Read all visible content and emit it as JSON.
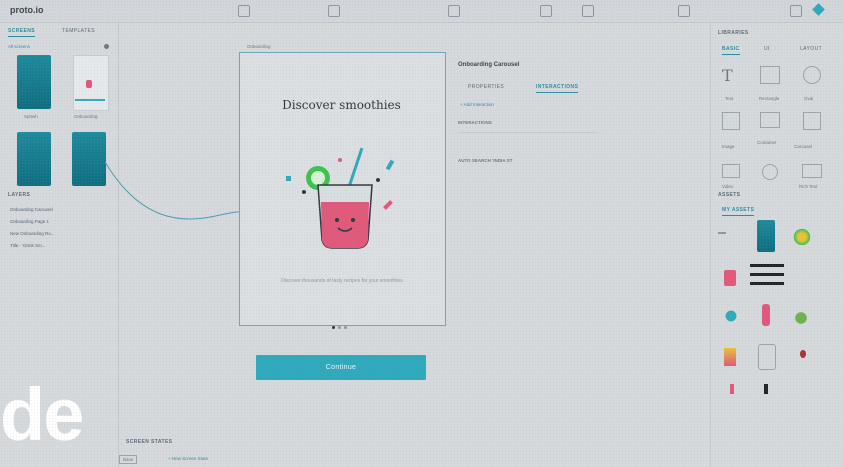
{
  "app": {
    "logo": "proto.io"
  },
  "left_panel": {
    "tabs": [
      "SCREENS",
      "TEMPLATES"
    ],
    "filter_label": "All screens",
    "screens": [
      {
        "label": "Splash"
      },
      {
        "label": "Onboarding"
      },
      {
        "label": ""
      },
      {
        "label": ""
      }
    ],
    "layers_title": "LAYERS",
    "layers": [
      "Onboarding Carousel",
      "Onboarding Page 1",
      "New Onboarding Ro...",
      "Title - 'Drink Sm..."
    ]
  },
  "canvas": {
    "artboard_title": "Discover smoothies",
    "artboard_caption": "Discover thousands of tasty recipes for your smoothies",
    "continue_label": "Continue"
  },
  "props_panel": {
    "title": "Onboarding Carousel",
    "tabs": [
      "PROPERTIES",
      "INTERACTIONS"
    ],
    "add_interaction": "+ Add Interaction",
    "interaction_label": "INTERACTIONS",
    "auto_label": "AUTO SEARCH 'INDIA ST"
  },
  "right_panel": {
    "library_title": "LIBRARIES",
    "library_tabs": [
      "BASIC",
      "UI",
      "LAYOUT"
    ],
    "items": [
      "Text",
      "Rectangle",
      "Oval",
      "Image",
      "Container",
      "Carousel",
      "Video",
      "",
      "Rich Text"
    ],
    "assets_title": "ASSETS",
    "assets_tab": "MY ASSETS"
  },
  "bottom_bar": {
    "screen_states": "SCREEN STATES",
    "state_base": "Base",
    "add_state": "+ New Screen State"
  },
  "overlay_text": "de",
  "colors": {
    "accent": "#2fa9bc",
    "panel": "#d6d9dc",
    "jar": "#e0587a",
    "lime": "#3cc24e"
  }
}
